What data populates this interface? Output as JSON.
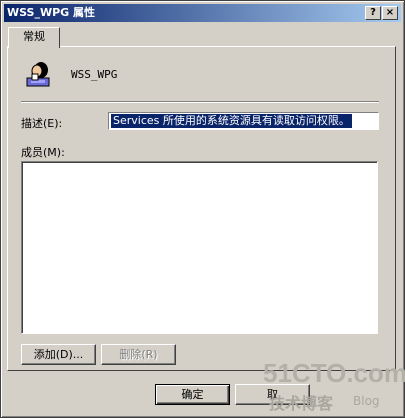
{
  "window": {
    "title": "WSS_WPG 属性",
    "help_btn": "?",
    "close_btn": "×"
  },
  "tabs": [
    {
      "label": "常规"
    }
  ],
  "group": {
    "name": "WSS_WPG"
  },
  "description": {
    "label": "描述(E):",
    "value": "Services 所使用的系统资源具有读取访问权限。"
  },
  "members": {
    "label": "成员(M):",
    "items": []
  },
  "buttons": {
    "add": "添加(D)...",
    "remove": "删除(R)",
    "ok": "确定",
    "cancel": "取"
  },
  "watermark": {
    "line1": "51CTO.com",
    "line2": "技术博客",
    "line3": "Blog"
  }
}
